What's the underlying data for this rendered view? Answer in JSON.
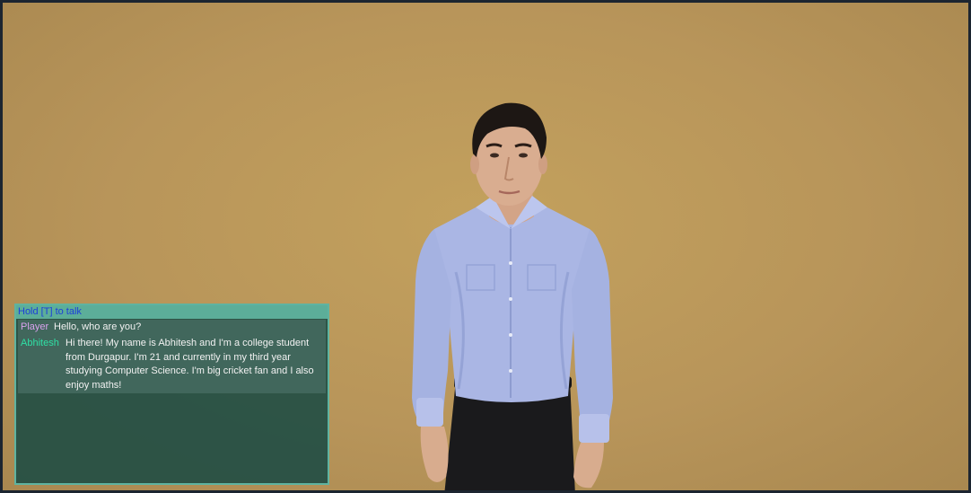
{
  "hud": {
    "talk_hint": "Hold [T] to talk"
  },
  "chat": {
    "messages": [
      {
        "speaker": "Player",
        "text": "Hello, who are you?"
      },
      {
        "speaker": "Abhitesh",
        "text": "Hi there! My name is Abhitesh and I'm a college student from Durgapur. I'm 21 and currently in my third year studying Computer Science. I'm big cricket fan and I also enjoy maths!"
      }
    ]
  },
  "colors": {
    "background": "#b8955a",
    "panel": "#224e44",
    "header": "#5cae99",
    "hint_text": "#1d3fd8",
    "player_name": "#d9a2ee",
    "npc_name": "#2fe0a5"
  }
}
